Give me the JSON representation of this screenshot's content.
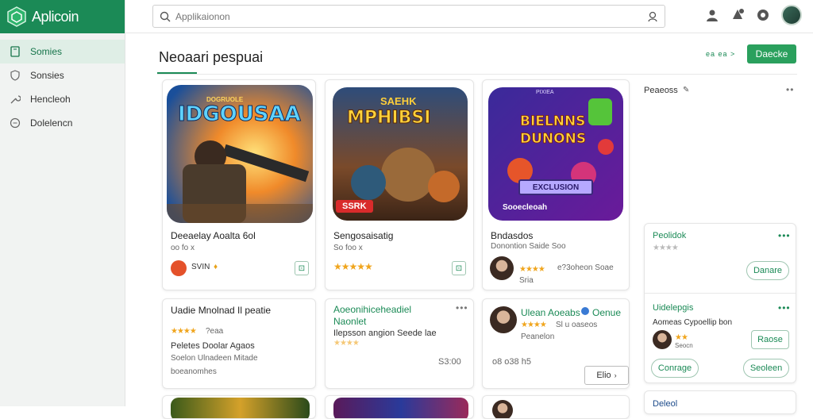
{
  "app": {
    "name": "Aplicoin",
    "accent": "#1b8a56"
  },
  "search": {
    "placeholder": "Applikaionon"
  },
  "sidebar": {
    "items": [
      {
        "label": "Somies",
        "icon": "book-icon",
        "active": true
      },
      {
        "label": "Sonsies",
        "icon": "shield-icon"
      },
      {
        "label": "Hencleoh",
        "icon": "wrench-icon"
      },
      {
        "label": "Dolelencn",
        "icon": "clock-icon"
      }
    ]
  },
  "header": {
    "section_title": "Neoaari pespuai",
    "see_more": "ea  ea >",
    "get_label": "Daecke"
  },
  "featured": [
    {
      "art_title": "IDGOUSAA",
      "art_banner": "DOGRUOLE",
      "title": "Deeaelay Aoalta 6ol",
      "sub": "oo fo x",
      "badge": "SVIN",
      "rating_icon": "flame-icon"
    },
    {
      "art_title": "MPHIBSI",
      "art_banner": "SAEHK",
      "art_tag": "SSRK",
      "title": "Sengosaisatig",
      "sub": "So foo x",
      "stars": "★★★★★"
    },
    {
      "art_title": "BIELNNS DUNONS",
      "art_banner": "PIXIEA",
      "art_button": "EXCLUSION",
      "art_footer": "Sooecleoah",
      "title": "Bndasdos",
      "sub": "Donontion Saide Soo",
      "stars": "★★★★",
      "extra": "e?3oheon Soae",
      "extra2": "Sria"
    }
  ],
  "list_cards": [
    {
      "title": "Uadie Mnolnad Il peatie",
      "stars": "★★★★",
      "rating": "?eaa",
      "l1": "Peletes Doolar Agaos",
      "l2": "Soelon Ulnadeen Mitade",
      "l3": "boeanomhes"
    },
    {
      "title": "Aoeonihiceheadiel Naonlet",
      "stars": "★★★★",
      "l1": "Ilepsson angion Seede lae",
      "price": "S3:00"
    },
    {
      "title": "Ulean Aoeabs",
      "app": "Oenue",
      "stars": "★★★★",
      "rating": "Sl u oaseos",
      "l1": "Peanelon",
      "meta": "o8 o38 h5",
      "button": "Elio"
    }
  ],
  "right_panel": {
    "title": "Peaeoss",
    "card1": {
      "title": "Peolidok",
      "stars": "★★★★",
      "button": "Danare"
    },
    "card2": {
      "title": "Uidelepgis",
      "sub": "Aomeas Cypoellip bon",
      "stars": "★★",
      "rating": "Seocn",
      "button": "Raose",
      "btn_left": "Conrage",
      "btn_right": "Seoleen"
    },
    "card3": {
      "title": "Deleol"
    }
  }
}
